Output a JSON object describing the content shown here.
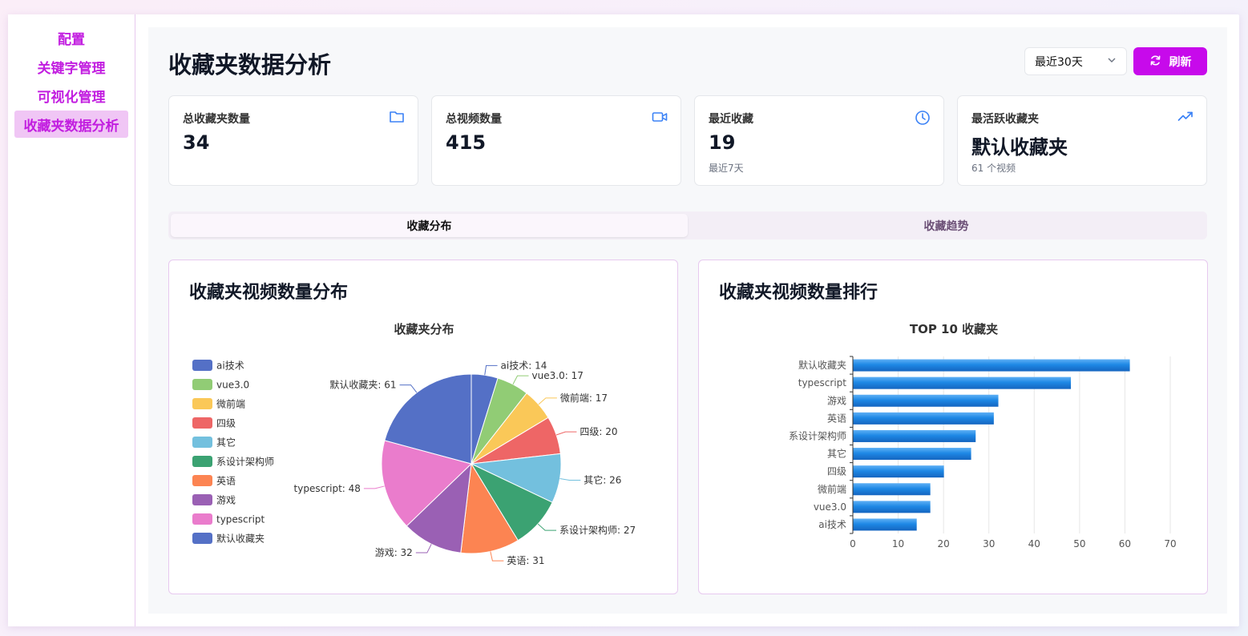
{
  "sidebar": {
    "items": [
      {
        "label": "配置",
        "active": false
      },
      {
        "label": "关键字管理",
        "active": false
      },
      {
        "label": "可视化管理",
        "active": false
      },
      {
        "label": "收藏夹数据分析",
        "active": true
      }
    ]
  },
  "header": {
    "title": "收藏夹数据分析",
    "range": "最近30天",
    "refresh_label": "刷新"
  },
  "stats": [
    {
      "label": "总收藏夹数量",
      "value": "34",
      "sub": "",
      "icon": "folder-icon"
    },
    {
      "label": "总视频数量",
      "value": "415",
      "sub": "",
      "icon": "video-icon"
    },
    {
      "label": "最近收藏",
      "value": "19",
      "sub": "最近7天",
      "icon": "clock-icon"
    },
    {
      "label": "最活跃收藏夹",
      "value": "默认收藏夹",
      "sub": "61 个视频",
      "icon": "trending-up-icon"
    }
  ],
  "tabs": [
    {
      "label": "收藏分布",
      "active": true
    },
    {
      "label": "收藏趋势",
      "active": false
    }
  ],
  "colors": {
    "accent": "#c70aeb",
    "nav_text": "#c21ee0",
    "icon_blue": "#3b82f6"
  },
  "chart_data": [
    {
      "type": "pie",
      "card_title": "收藏夹视频数量分布",
      "title": "收藏夹分布",
      "legend_position": "left",
      "slices": [
        {
          "name": "ai技术",
          "value": 14,
          "color": "#5470c6"
        },
        {
          "name": "vue3.0",
          "value": 17,
          "color": "#91cc75"
        },
        {
          "name": "微前端",
          "value": 17,
          "color": "#fac858"
        },
        {
          "name": "四级",
          "value": 20,
          "color": "#ee6666"
        },
        {
          "name": "其它",
          "value": 26,
          "color": "#73c0de"
        },
        {
          "name": "系设计架构师",
          "value": 27,
          "color": "#3ba272"
        },
        {
          "name": "英语",
          "value": 31,
          "color": "#fc8452"
        },
        {
          "name": "游戏",
          "value": 32,
          "color": "#9a60b4"
        },
        {
          "name": "typescript",
          "value": 48,
          "color": "#ea7ccc"
        },
        {
          "name": "默认收藏夹",
          "value": 61,
          "color": "#5470c6"
        }
      ]
    },
    {
      "type": "bar",
      "orientation": "horizontal",
      "card_title": "收藏夹视频数量排行",
      "title": "TOP 10 收藏夹",
      "categories": [
        "默认收藏夹",
        "typescript",
        "游戏",
        "英语",
        "系设计架构师",
        "其它",
        "四级",
        "微前端",
        "vue3.0",
        "ai技术"
      ],
      "values": [
        61,
        48,
        32,
        31,
        27,
        26,
        20,
        17,
        17,
        14
      ],
      "xlim": [
        0,
        70
      ],
      "xticks": [
        0,
        10,
        20,
        30,
        40,
        50,
        60,
        70
      ],
      "grid": true,
      "bar_color": "#1e88e5"
    }
  ]
}
